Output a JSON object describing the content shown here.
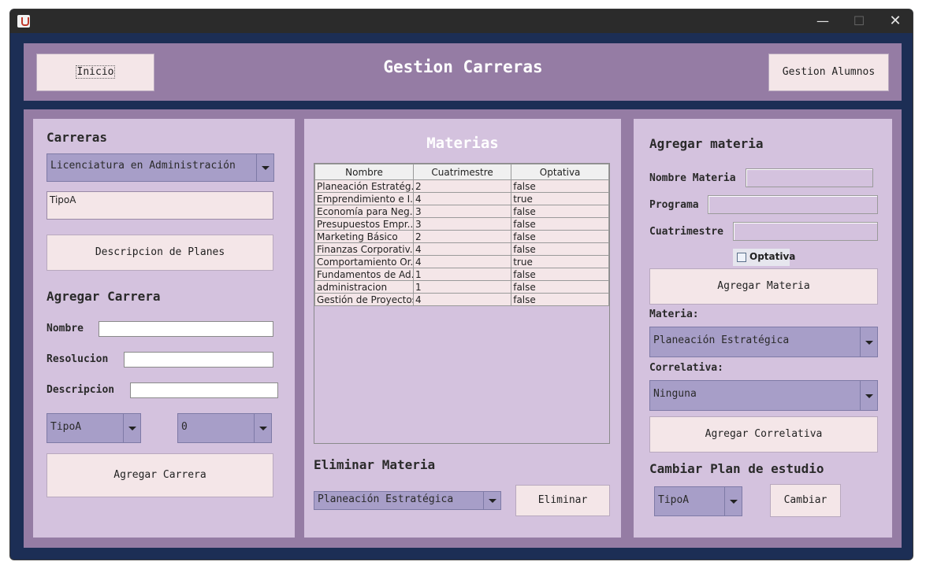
{
  "window": {
    "minimize": "—",
    "maximize": "☐",
    "close": "✕"
  },
  "header": {
    "title": "Gestion Carreras",
    "inicio_label": "Inicio",
    "alumnos_label": "Gestion Alumnos"
  },
  "left": {
    "carreras_title": "Carreras",
    "carrera_selected": "Licenciatura en Administración",
    "tipo_text": "TipoA",
    "descripcion_button": "Descripcion de Planes",
    "agregar_title": "Agregar Carrera",
    "nombre_label": "Nombre",
    "resolucion_label": "Resolucion",
    "descripcion_label": "Descripcion",
    "tipo_selected": "TipoA",
    "numero_selected": "0",
    "agregar_button": "Agregar Carrera"
  },
  "center": {
    "title": "Materias",
    "columns": [
      "Nombre",
      "Cuatrimestre",
      "Optativa"
    ],
    "rows": [
      [
        "Planeación Estratég...",
        "2",
        "false"
      ],
      [
        "Emprendimiento e I...",
        "4",
        "true"
      ],
      [
        "Economía para Neg...",
        "3",
        "false"
      ],
      [
        "Presupuestos Empr...",
        "3",
        "false"
      ],
      [
        "Marketing Básico",
        "2",
        "false"
      ],
      [
        "Finanzas Corporativ...",
        "4",
        "false"
      ],
      [
        "Comportamiento Or...",
        "4",
        "true"
      ],
      [
        "Fundamentos de Ad...",
        "1",
        "false"
      ],
      [
        "administracion",
        "1",
        "false"
      ],
      [
        "Gestión de Proyectos",
        "4",
        "false"
      ]
    ],
    "eliminar_title": "Eliminar Materia",
    "eliminar_selected": "Planeación Estratégica",
    "eliminar_button": "Eliminar"
  },
  "right": {
    "agregar_title": "Agregar materia",
    "nombre_label": "Nombre Materia",
    "programa_label": "Programa",
    "cuatrimestre_label": "Cuatrimestre",
    "optativa_label": "Optativa",
    "agregar_button": "Agregar Materia",
    "materia_label": "Materia:",
    "materia_selected": "Planeación Estratégica",
    "correlativa_label": "Correlativa:",
    "correlativa_selected": "Ninguna",
    "agregar_correlativa_button": "Agregar Correlativa",
    "cambiar_title": "Cambiar Plan de estudio",
    "plan_selected": "TipoA",
    "cambiar_button": "Cambiar"
  }
}
